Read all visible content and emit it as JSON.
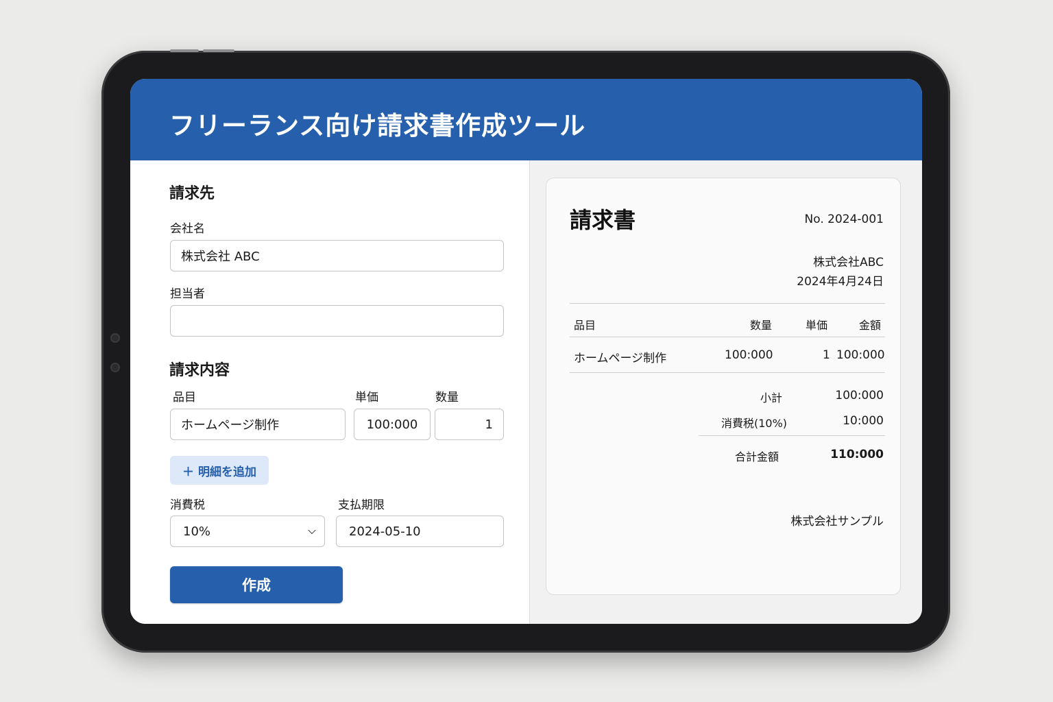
{
  "app": {
    "title": "フリーランス向け請求書作成ツール"
  },
  "form": {
    "billing_to_heading": "請求先",
    "company_label": "会社名",
    "company_value": "株式会社 ABC",
    "contact_label": "担当者",
    "contact_value": "",
    "details_heading": "請求内容",
    "item_label": "品目",
    "unit_price_label": "単価",
    "quantity_label": "数量",
    "item_value": "ホームページ制作",
    "unit_price_value": "100:000",
    "quantity_value": "1",
    "add_item_label": "＋ 明細を追加",
    "tax_label": "消費税",
    "tax_value": "10%",
    "due_label": "支払期限",
    "due_value": "2024-05-10",
    "create_label": "作成"
  },
  "preview": {
    "title": "請求書",
    "number": "No. 2024-001",
    "client": "株式会社ABC",
    "date": "2024年4月24日",
    "columns": {
      "item": "品目",
      "quantity": "数量",
      "unit_price": "単価",
      "amount": "金額"
    },
    "rows": [
      {
        "item": "ホームページ制作",
        "quantity": "100:000",
        "unit_price": "1",
        "amount": "100:000"
      }
    ],
    "subtotal_label": "小計",
    "subtotal_value": "100:000",
    "tax_label": "消費税(10%)",
    "tax_value": "10:000",
    "total_label": "合計金額",
    "total_value": "110:000",
    "issuer": "株式会社サンプル"
  },
  "colors": {
    "brand": "#2660ad",
    "accent_light": "#dde9f8"
  }
}
